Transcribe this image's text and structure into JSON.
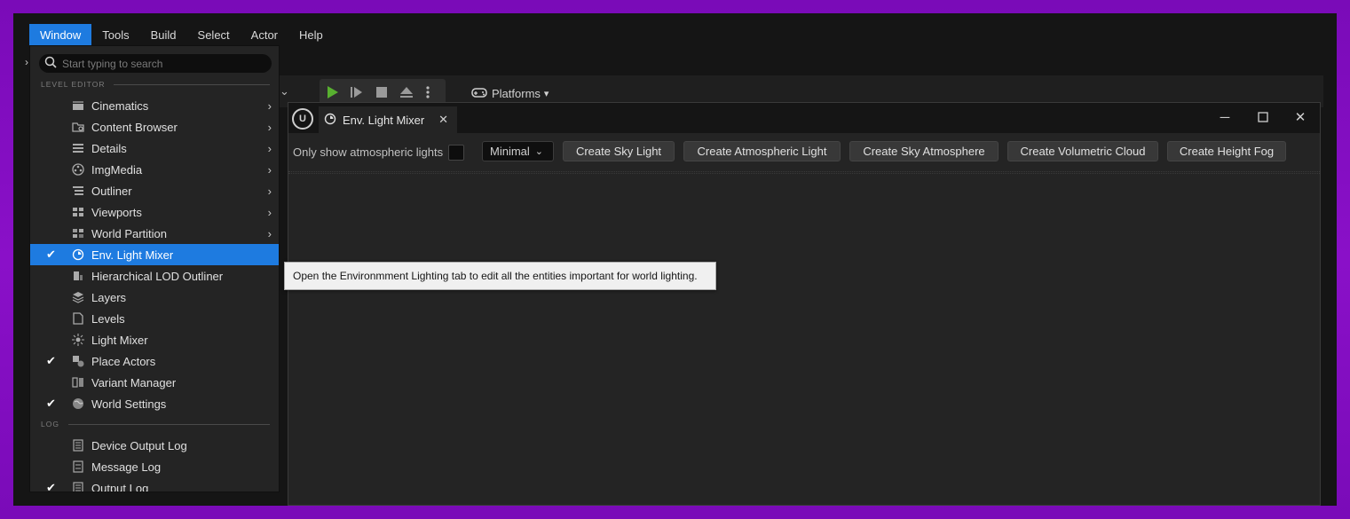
{
  "menubar": {
    "items": [
      {
        "label": "Window",
        "active": true
      },
      {
        "label": "Tools",
        "active": false
      },
      {
        "label": "Build",
        "active": false
      },
      {
        "label": "Select",
        "active": false
      },
      {
        "label": "Actor",
        "active": false
      },
      {
        "label": "Help",
        "active": false
      }
    ],
    "accent": "#1e7be0"
  },
  "toolbar": {
    "platforms_label": "Platforms"
  },
  "window_menu": {
    "search_placeholder": "Start typing to search",
    "level_editor_header": "LEVEL EDITOR",
    "log_header": "LOG",
    "items": [
      {
        "label": "Cinematics",
        "icon": "clapperboard-icon",
        "submenu": true,
        "checked": false
      },
      {
        "label": "Content Browser",
        "icon": "content-browser-icon",
        "submenu": true,
        "checked": false
      },
      {
        "label": "Details",
        "icon": "details-icon",
        "submenu": true,
        "checked": false
      },
      {
        "label": "ImgMedia",
        "icon": "film-reel-icon",
        "submenu": true,
        "checked": false
      },
      {
        "label": "Outliner",
        "icon": "outliner-icon",
        "submenu": true,
        "checked": false
      },
      {
        "label": "Viewports",
        "icon": "viewports-icon",
        "submenu": true,
        "checked": false
      },
      {
        "label": "World Partition",
        "icon": "world-partition-icon",
        "submenu": true,
        "checked": false
      },
      {
        "label": "Env. Light Mixer",
        "icon": "env-light-icon",
        "submenu": false,
        "checked": true,
        "highlighted": true
      },
      {
        "label": "Hierarchical LOD Outliner",
        "icon": "hlod-icon",
        "submenu": false,
        "checked": false
      },
      {
        "label": "Layers",
        "icon": "layers-icon",
        "submenu": false,
        "checked": false
      },
      {
        "label": "Levels",
        "icon": "levels-icon",
        "submenu": false,
        "checked": false
      },
      {
        "label": "Light Mixer",
        "icon": "light-mixer-icon",
        "submenu": false,
        "checked": false
      },
      {
        "label": "Place Actors",
        "icon": "place-actors-icon",
        "submenu": false,
        "checked": true
      },
      {
        "label": "Variant Manager",
        "icon": "variant-manager-icon",
        "submenu": false,
        "checked": false
      },
      {
        "label": "World Settings",
        "icon": "globe-icon",
        "submenu": false,
        "checked": true
      }
    ],
    "log_items": [
      {
        "label": "Device Output Log",
        "icon": "log-icon",
        "checked": false
      },
      {
        "label": "Message Log",
        "icon": "message-log-icon",
        "checked": false
      },
      {
        "label": "Output Log",
        "icon": "log-icon",
        "checked": true
      }
    ]
  },
  "tooltip": {
    "text": "Open the Environmment Lighting tab to edit all the entities important for world lighting."
  },
  "env_window": {
    "tab_label": "Env. Light Mixer",
    "checkbox_label": "Only show atmospheric lights",
    "view_mode": "Minimal",
    "buttons": [
      "Create Sky Light",
      "Create Atmospheric Light",
      "Create Sky Atmosphere",
      "Create Volumetric Cloud",
      "Create Height Fog"
    ]
  }
}
